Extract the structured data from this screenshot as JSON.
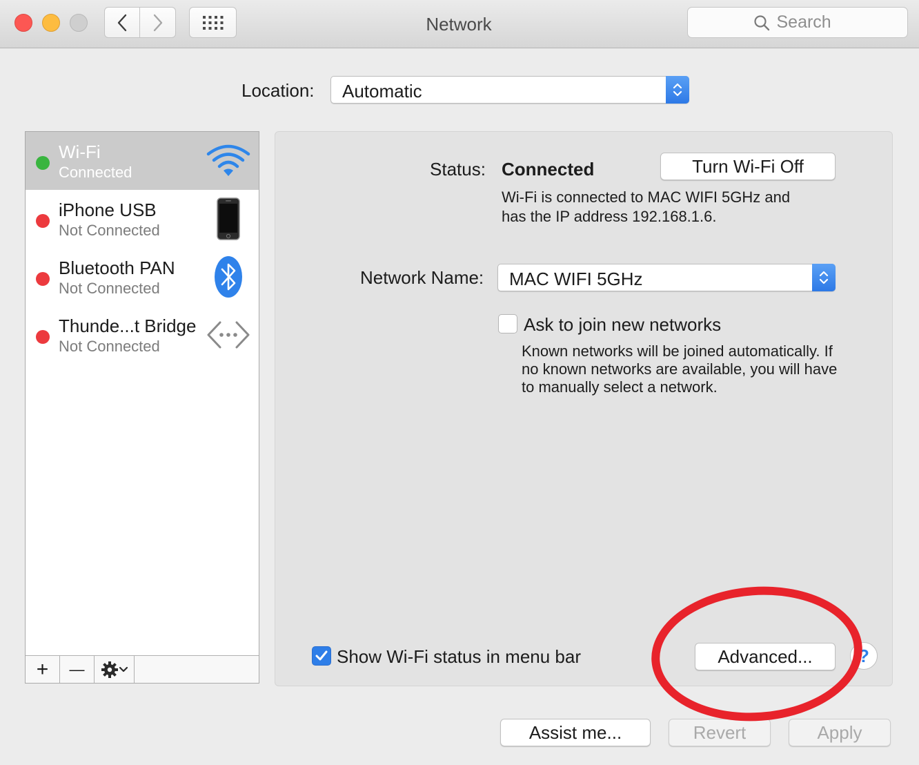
{
  "window": {
    "title": "Network",
    "search_placeholder": "Search"
  },
  "location": {
    "label": "Location:",
    "value": "Automatic"
  },
  "services": [
    {
      "name": "Wi-Fi",
      "status": "Connected",
      "indicator": "green",
      "icon": "wifi-icon",
      "selected": true
    },
    {
      "name": "iPhone USB",
      "status": "Not Connected",
      "indicator": "red",
      "icon": "iphone-icon",
      "selected": false
    },
    {
      "name": "Bluetooth PAN",
      "status": "Not Connected",
      "indicator": "red",
      "icon": "bluetooth-icon",
      "selected": false
    },
    {
      "name": "Thunde...t Bridge",
      "status": "Not Connected",
      "indicator": "red",
      "icon": "thunderbolt-bridge-icon",
      "selected": false
    }
  ],
  "sidebar_toolbar": {
    "add": "+",
    "remove": "—"
  },
  "detail": {
    "status_label": "Status:",
    "status_value": "Connected",
    "turn_off_button": "Turn Wi-Fi Off",
    "status_desc_line1": "Wi-Fi is connected to MAC WIFI 5GHz and",
    "status_desc_line2": "has the IP address 192.168.1.6.",
    "network_name_label": "Network Name:",
    "network_name_value": "MAC WIFI 5GHz",
    "ask_join_label": "Ask to join new networks",
    "ask_join_checked": false,
    "ask_join_desc_line1": "Known networks will be joined automatically. If",
    "ask_join_desc_line2": "no known networks are available, you will have",
    "ask_join_desc_line3": "to manually select a network.",
    "show_status_label": "Show Wi-Fi status in menu bar",
    "show_status_checked": true,
    "advanced_button": "Advanced...",
    "help_button": "?"
  },
  "footer": {
    "assist_button": "Assist me...",
    "revert_button": "Revert",
    "apply_button": "Apply"
  },
  "colors": {
    "accent": "#2e7ee8",
    "connected": "#39b53f",
    "disconnected": "#ec3a3e",
    "annotation": "#e8232b"
  }
}
